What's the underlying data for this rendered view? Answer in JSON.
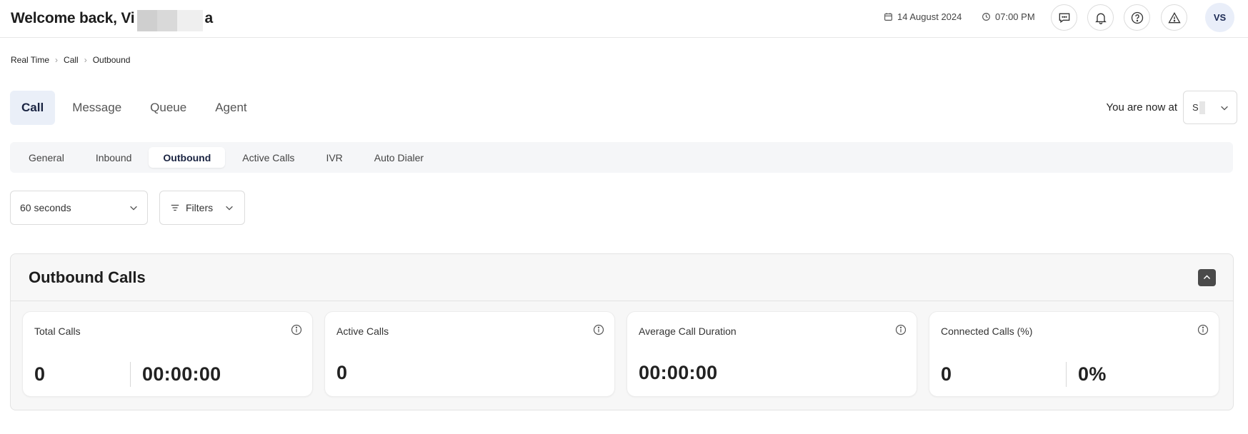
{
  "header": {
    "welcome_prefix": "Welcome back, Vi",
    "welcome_suffix": "a",
    "date": "14 August 2024",
    "time": "07:00 PM",
    "avatar_initials": "VS"
  },
  "breadcrumb": [
    "Real Time",
    "Call",
    "Outbound"
  ],
  "main_tabs": [
    "Call",
    "Message",
    "Queue",
    "Agent"
  ],
  "location": {
    "label": "You are now at",
    "value": "S"
  },
  "sub_tabs": [
    "General",
    "Inbound",
    "Outbound",
    "Active Calls",
    "IVR",
    "Auto Dialer"
  ],
  "controls": {
    "interval": "60 seconds",
    "filters_label": "Filters"
  },
  "panel": {
    "title": "Outbound Calls",
    "cards": [
      {
        "title": "Total Calls",
        "value1": "0",
        "value2": "00:00:00"
      },
      {
        "title": "Active Calls",
        "value1": "0"
      },
      {
        "title": "Average Call Duration",
        "value1": "00:00:00"
      },
      {
        "title": "Connected Calls (%)",
        "value1": "0",
        "value2": "0%"
      }
    ]
  },
  "colors": {
    "active_tab_bg": "#eaeff8",
    "accent_text": "#1a2442",
    "avatar_bg": "#e9eef9"
  }
}
